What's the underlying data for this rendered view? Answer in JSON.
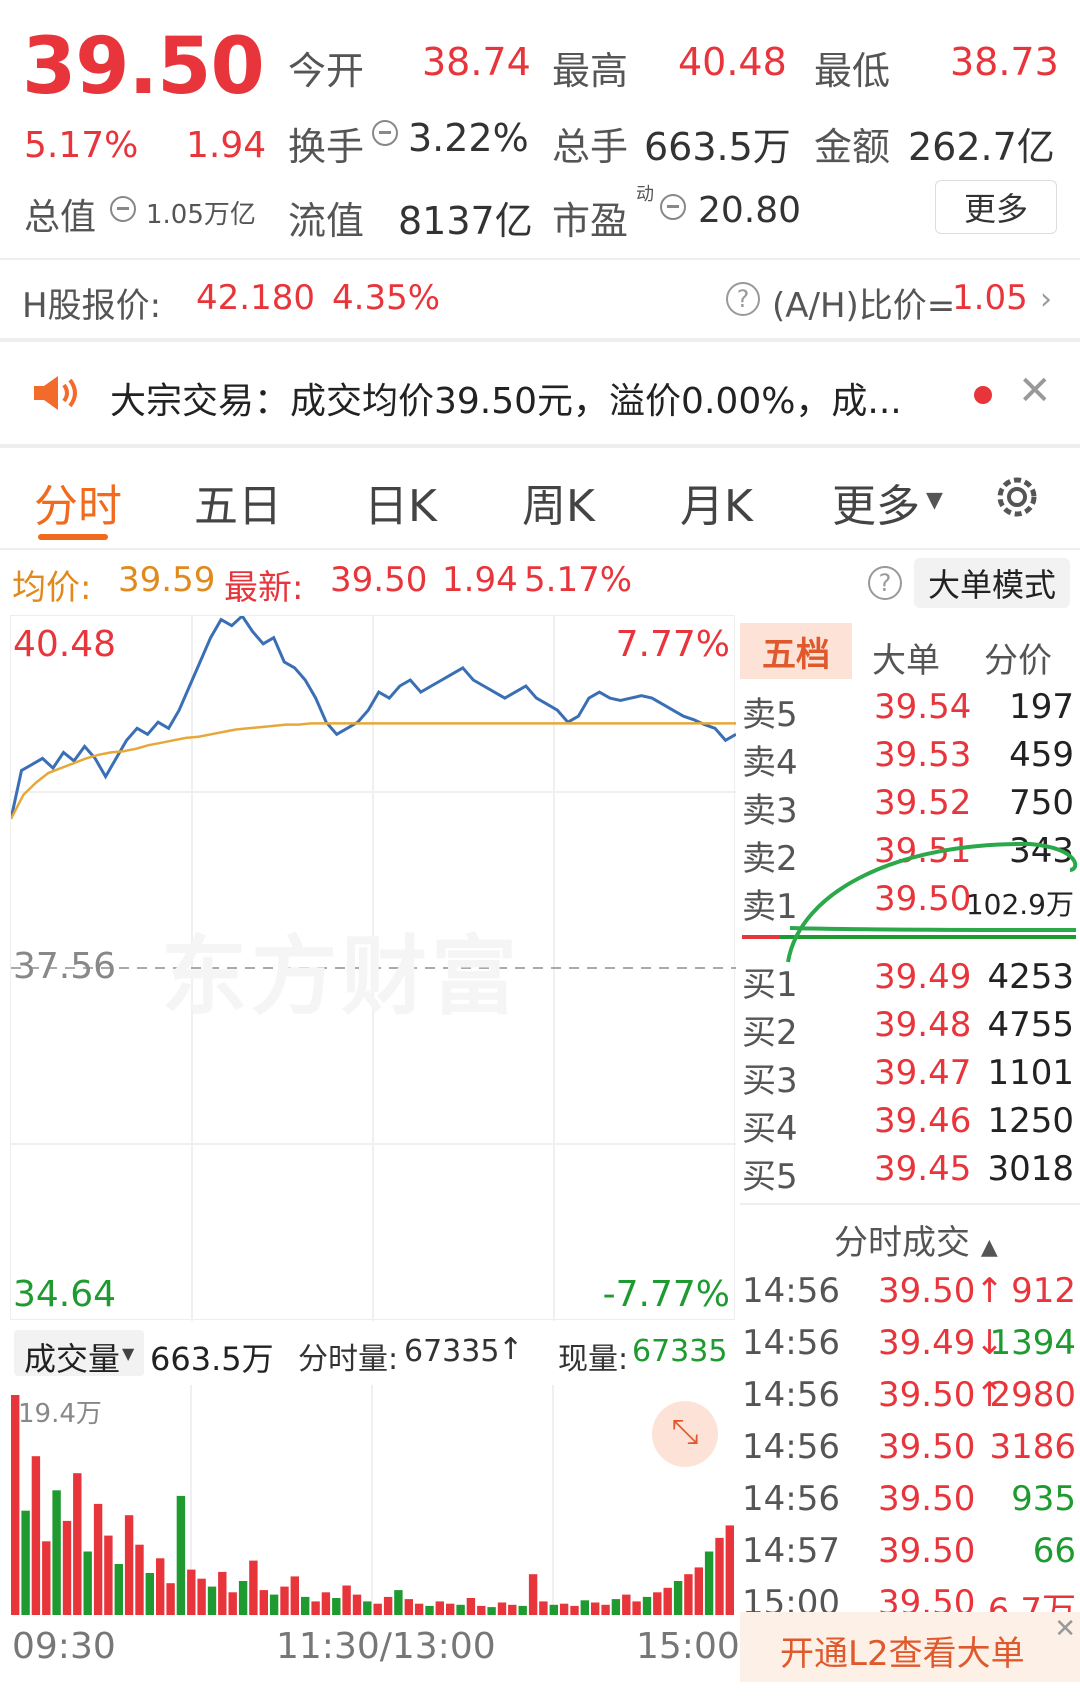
{
  "quote": {
    "price": "39.50",
    "change_pct": "5.17%",
    "change": "1.94",
    "open_label": "今开",
    "open_value": "38.74",
    "high_label": "最高",
    "high_value": "40.48",
    "low_label": "最低",
    "low_value": "38.73",
    "turnover_label": "换手",
    "turnover_value": "3.22%",
    "volume_label": "总手",
    "volume_value": "663.5万",
    "amount_label": "金额",
    "amount_value": "262.7亿",
    "mktcap_label": "总值",
    "mktcap_value": "1.05万亿",
    "float_label": "流值",
    "float_value": "8137亿",
    "pe_label": "市盈",
    "pe_sup": "动",
    "pe_value": "20.80",
    "more_button": "更多"
  },
  "hshare": {
    "label": "H股报价:",
    "price": "42.180",
    "pct": "4.35%",
    "ah_label": "(A/H)比价=",
    "ah_value": "1.05"
  },
  "notice": {
    "text": "大宗交易：成交均价39.50元，溢价0.00%，成..."
  },
  "tabs": [
    "分时",
    "五日",
    "日K",
    "周K",
    "月K",
    "更多"
  ],
  "info": {
    "avg_label": "均价:",
    "avg_value": "39.59",
    "latest_label": "最新:",
    "latest_value": "39.50",
    "latest_change": "1.94",
    "latest_pct": "5.17%",
    "mode_button": "大单模式"
  },
  "chart_labels": {
    "top_price": "40.48",
    "top_pct": "7.77%",
    "mid_price": "37.56",
    "bottom_price": "34.64",
    "bottom_pct": "-7.77%",
    "watermark": "东方财富"
  },
  "volume_bar": {
    "selector": "成交量",
    "total": "663.5万",
    "minute_label": "分时量:",
    "minute_value": "67335",
    "minute_arrow": "↑",
    "now_label": "现量:",
    "now_value": "67335",
    "max_label": "19.4万",
    "time_start": "09:30",
    "time_mid": "11:30/13:00",
    "time_end": "15:00"
  },
  "orderbook": {
    "tabs": [
      "五档",
      "大单",
      "分价"
    ],
    "asks": [
      {
        "label": "卖5",
        "price": "39.54",
        "vol": "197"
      },
      {
        "label": "卖4",
        "price": "39.53",
        "vol": "459"
      },
      {
        "label": "卖3",
        "price": "39.52",
        "vol": "750"
      },
      {
        "label": "卖2",
        "price": "39.51",
        "vol": "343"
      },
      {
        "label": "卖1",
        "price": "39.50",
        "vol": "102.9万"
      }
    ],
    "bids": [
      {
        "label": "买1",
        "price": "39.49",
        "vol": "4253"
      },
      {
        "label": "买2",
        "price": "39.48",
        "vol": "4755"
      },
      {
        "label": "买3",
        "price": "39.47",
        "vol": "1101"
      },
      {
        "label": "买4",
        "price": "39.46",
        "vol": "1250"
      },
      {
        "label": "买5",
        "price": "39.45",
        "vol": "3018"
      }
    ],
    "trades_title": "分时成交",
    "trades": [
      {
        "time": "14:56",
        "price": "39.50↑",
        "vol": "912",
        "color": "#e8353b"
      },
      {
        "time": "14:56",
        "price": "39.49↓",
        "vol": "1394",
        "color": "#1f9a31"
      },
      {
        "time": "14:56",
        "price": "39.50↑",
        "vol": "2980",
        "color": "#e8353b"
      },
      {
        "time": "14:56",
        "price": "39.50",
        "vol": "3186",
        "color": "#e8353b"
      },
      {
        "time": "14:56",
        "price": "39.50",
        "vol": "935",
        "color": "#1f9a31"
      },
      {
        "time": "14:57",
        "price": "39.50",
        "vol": "66",
        "color": "#1f9a31"
      },
      {
        "time": "15:00",
        "price": "39.50",
        "vol": "6.7万",
        "color": "#e8353b"
      }
    ],
    "l2_banner": "开通L2查看大单"
  },
  "chart_data": {
    "type": "line",
    "series": [
      {
        "values": [
          38.8,
          39.2,
          39.25,
          39.3,
          39.22,
          39.35,
          39.28,
          39.4,
          39.3,
          39.15,
          39.3,
          39.45,
          39.55,
          39.5,
          39.6,
          39.55,
          39.7,
          39.9,
          40.1,
          40.3,
          40.45,
          40.4,
          40.48,
          40.35,
          40.25,
          40.3,
          40.1,
          40.05,
          39.95,
          39.8,
          39.6,
          39.5,
          39.55,
          39.6,
          39.7,
          39.85,
          39.8,
          39.9,
          39.95,
          39.85,
          39.9,
          39.95,
          40.0,
          40.05,
          39.95,
          39.9,
          39.85,
          39.8,
          39.85,
          39.9,
          39.8,
          39.75,
          39.7,
          39.6,
          39.65,
          39.8,
          39.85,
          39.8,
          39.78,
          39.8,
          39.82,
          39.8,
          39.75,
          39.7,
          39.65,
          39.62,
          39.58,
          39.55,
          39.45,
          39.5
        ]
      },
      {
        "values": [
          38.8,
          39.0,
          39.1,
          39.18,
          39.22,
          39.26,
          39.3,
          39.33,
          39.35,
          39.36,
          39.38,
          39.41,
          39.43,
          39.45,
          39.47,
          39.48,
          39.5,
          39.52,
          39.54,
          39.55,
          39.56,
          39.57,
          39.58,
          39.58,
          39.59,
          39.59,
          39.59,
          39.59,
          39.59,
          39.59
        ]
      }
    ],
    "ylim": [
      34.64,
      40.48
    ],
    "volumes": [
      19.4,
      9.2,
      14.0,
      6.5,
      11.0,
      8.3,
      12.5,
      5.6,
      9.8,
      7.0,
      4.5,
      8.8,
      6.2,
      3.7,
      5.0,
      2.8,
      10.5,
      4.0,
      3.2,
      2.5,
      3.8,
      2.0,
      3.0,
      4.8,
      2.2,
      1.8,
      2.5,
      3.4,
      1.6,
      1.2,
      2.0,
      1.5,
      2.6,
      1.8,
      1.2,
      1.0,
      1.6,
      2.2,
      1.4,
      1.0,
      0.8,
      1.2,
      1.0,
      0.9,
      1.5,
      0.8,
      0.7,
      1.1,
      0.9,
      0.8,
      3.6,
      1.2,
      0.9,
      1.0,
      0.8,
      1.3,
      1.1,
      0.9,
      1.4,
      1.8,
      1.2,
      1.6,
      2.0,
      2.4,
      3.0,
      3.6,
      4.2,
      5.6,
      6.8,
      7.9
    ]
  }
}
